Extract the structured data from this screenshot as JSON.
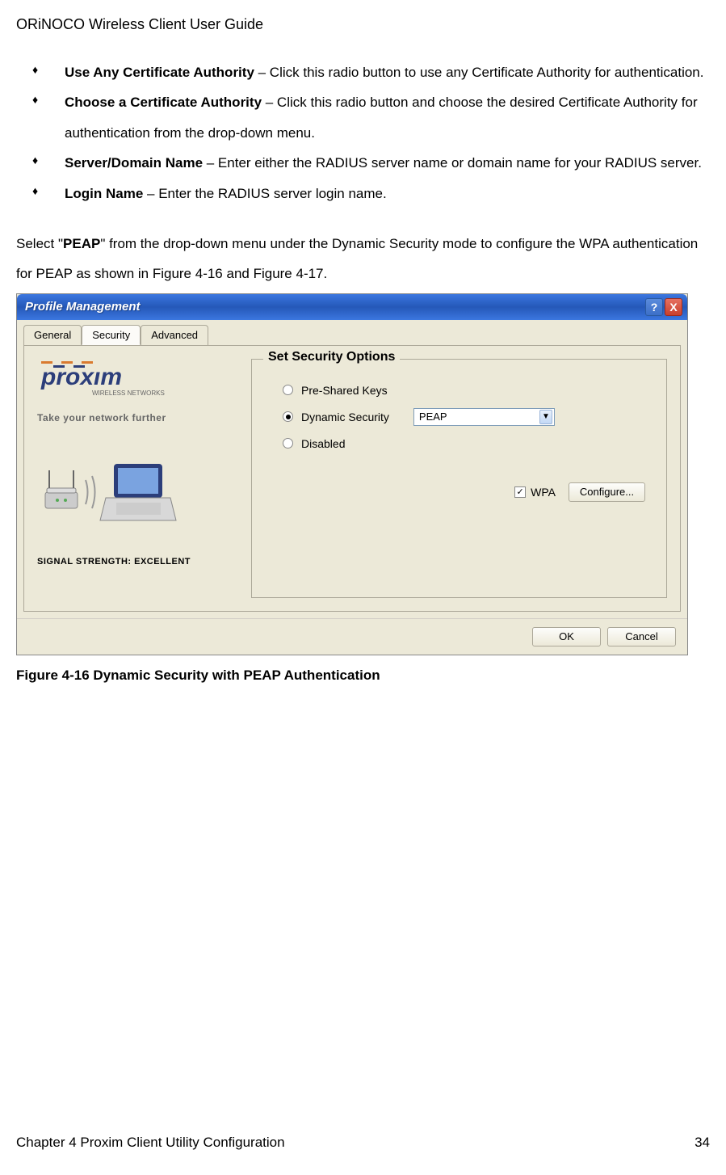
{
  "header": "ORiNOCO Wireless Client User Guide",
  "bullets": [
    {
      "title": "Use Any Certificate Authority",
      "text": " – Click this radio button to use any Certificate Authority for authentication."
    },
    {
      "title": "Choose a Certificate Authority",
      "text": " – Click this radio button and choose the desired Certificate Authority for authentication from the drop-down menu."
    },
    {
      "title": "Server/Domain Name",
      "text": " – Enter either the RADIUS server name or domain name for your RADIUS server."
    },
    {
      "title": "Login Name",
      "text": " – Enter the RADIUS server login name."
    }
  ],
  "para_pre": "Select \"",
  "para_peap": "PEAP",
  "para_post": "\" from the drop-down menu under the Dynamic Security mode to configure the WPA authentication for PEAP as shown in Figure 4-16 and Figure 4-17.",
  "dialog": {
    "title": "Profile Management",
    "tabs": [
      "General",
      "Security",
      "Advanced"
    ],
    "tagline": "Take your network further",
    "wireless_word": "WIRELESS NETWORKS",
    "signal": "SIGNAL STRENGTH: EXCELLENT",
    "group_title": "Set Security Options",
    "radios": [
      "Pre-Shared Keys",
      "Dynamic Security",
      "Disabled"
    ],
    "dropdown_value": "PEAP",
    "wpa_label": "WPA",
    "configure_btn": "Configure...",
    "ok_btn": "OK",
    "cancel_btn": "Cancel",
    "help_char": "?",
    "close_char": "X"
  },
  "figure_caption": "Figure 4-16  Dynamic Security with PEAP Authentication",
  "footer_left": "Chapter 4 Proxim Client Utility Configuration",
  "footer_right": "34"
}
